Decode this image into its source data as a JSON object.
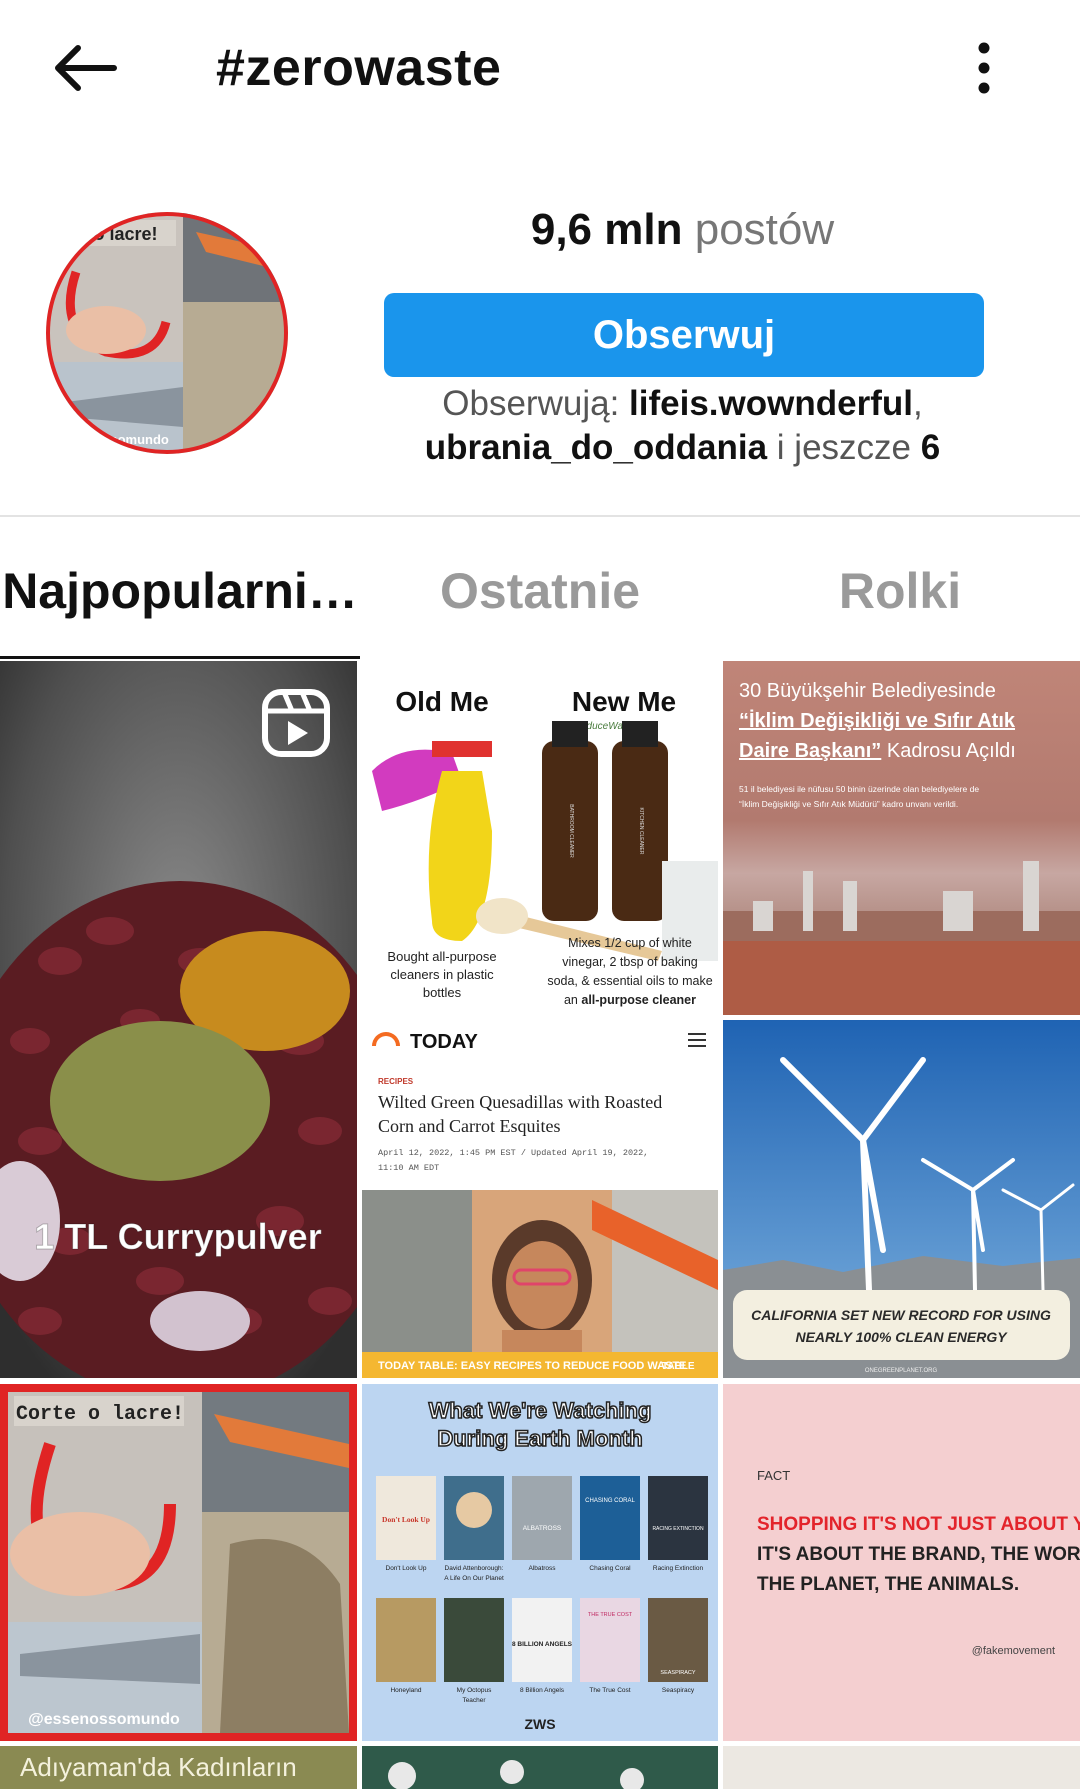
{
  "header": {
    "title": "#zerowaste",
    "back_icon": "arrow-left-icon",
    "more_icon": "more-vertical-icon"
  },
  "profile": {
    "post_count": "9,6 mln",
    "post_count_label": "postów",
    "follow_label": "Obserwuj",
    "followed_prefix": "Obserwują:",
    "followed_user1": "lifeis.wownderful",
    "followed_comma": ",",
    "followed_user2": "ubrania_do_oddania",
    "followed_mid": "i jeszcze",
    "followed_more": "6",
    "avatar_caption_top": "e o lacre!",
    "avatar_caption_bottom": "ssomundo"
  },
  "tabs": [
    {
      "label": "Najpopularni…"
    },
    {
      "label": "Ostatnie"
    },
    {
      "label": "Rolki"
    }
  ],
  "grid": {
    "p1": {
      "caption": "1 TL Currypulver",
      "icon": "reels-icon"
    },
    "p2": {
      "left_title": "Old Me",
      "right_title": "New Me",
      "handle": "@ReduceWasteNow",
      "left_caption_1": "Bought all-purpose",
      "left_caption_2": "cleaners in plastic",
      "left_caption_3": "bottles",
      "right_caption_1": "Mixes 1/2 cup of white",
      "right_caption_2": "vinegar, 2 tbsp of baking",
      "right_caption_3": "soda, & essential oils to make",
      "right_caption_4a": "an",
      "right_caption_4b": "all-purpose cleaner",
      "bottle1": "BATHROOM CLEANER",
      "bottle2": "KITCHEN CLEANER"
    },
    "p3": {
      "line1": "30 Büyükşehir Belediyesinde",
      "line2": "“İklim Değişikliği ve Sıfır Atık",
      "line3a": "Daire Başkanı”",
      "line3b": "Kadrosu Açıldı",
      "small1": "51 il belediyesi ile nüfusu 50 binin üzerinde olan belediyelere de",
      "small2": "“İklim Değişikliği ve Sıfır Atık Müdürü” kadro unvanı verildi."
    },
    "p4": {
      "brand": "TODAY",
      "kicker": "RECIPES",
      "headline1": "Wilted Green Quesadillas with Roasted",
      "headline2": "Corn and Carrot Esquites",
      "dateline1": "April 12, 2022, 1:45 PM EST / Updated April 19, 2022,",
      "dateline2": "11:10 AM EDT",
      "banner": "TODAY TABLE: EASY RECIPES TO REDUCE FOOD WASTE",
      "table_label": "TABLE"
    },
    "p5": {
      "line1": "CALIFORNIA SET NEW RECORD FOR USING",
      "line2": "NEARLY 100% CLEAN ENERGY",
      "source": "ONEGREENPLANET.ORG"
    },
    "p6": {
      "caption": "Corte o lacre!",
      "handle": "@essenossomundo"
    },
    "p7": {
      "title1": "What We're Watching",
      "title2": "During Earth Month",
      "films": [
        {
          "name": "Don't Look Up",
          "sub": ""
        },
        {
          "name": "David Attenborough:",
          "sub": "A Life On Our Planet"
        },
        {
          "name": "Albatross",
          "sub": ""
        },
        {
          "name": "Chasing Coral",
          "sub": ""
        },
        {
          "name": "Racing Extinction",
          "sub": ""
        },
        {
          "name": "Honeyland",
          "sub": ""
        },
        {
          "name": "My Octopus",
          "sub": "Teacher"
        },
        {
          "name": "8 Billion Angels",
          "sub": ""
        },
        {
          "name": "The True Cost",
          "sub": ""
        },
        {
          "name": "Seaspiracy",
          "sub": ""
        }
      ],
      "poster_text_1": "Don't Look Up",
      "poster_text_3": "ALBATROSS",
      "poster_text_4": "CHASING CORAL",
      "poster_text_5": "RACING EXTINCTION",
      "poster_text_8": "8 BILLION ANGELS",
      "poster_text_9": "THE TRUE COST",
      "poster_text_10": "SEASPIRACY",
      "footer": "ZWS"
    },
    "p8": {
      "kicker": "FACT",
      "red1": "SHOPPING IT'S NOT JUST ABOUT YOU.",
      "black1": "IT'S ABOUT THE BRAND, THE WORKERS,",
      "black2": "THE PLANET, THE ANIMALS.",
      "handle": "@fakemovement"
    },
    "p9": {
      "caption": "Adıyaman'da Kadınların"
    }
  },
  "colors": {
    "accent": "#1a95ec",
    "text": "#111111",
    "muted": "#777777"
  }
}
